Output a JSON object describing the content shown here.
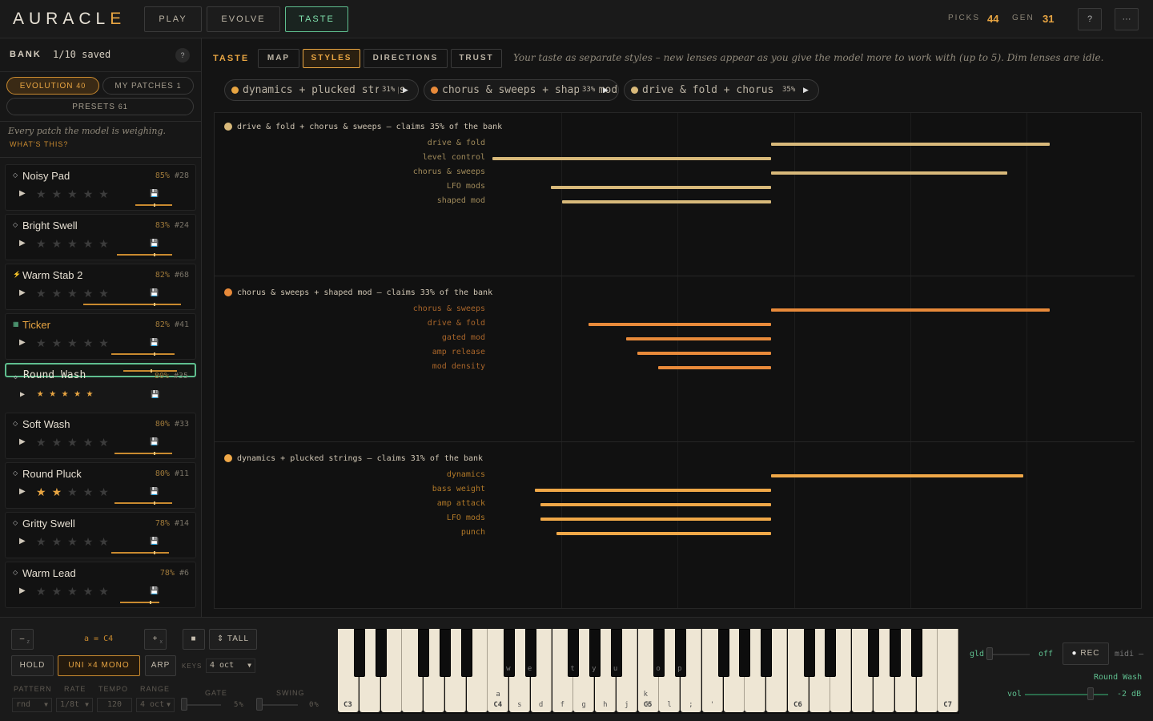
{
  "app": {
    "logo": "AURACLE",
    "logo_main": "AURACL",
    "logo_last": "E"
  },
  "top_tabs": [
    {
      "label": "PLAY"
    },
    {
      "label": "EVOLVE"
    },
    {
      "label": "TASTE",
      "active": true
    }
  ],
  "stats": {
    "picks_label": "PICKS",
    "picks": "44",
    "gen_label": "GEN",
    "gen": "31"
  },
  "top_buttons": {
    "help": "?",
    "more": "···"
  },
  "sidebar": {
    "bank_label": "BANK",
    "bank_saved": "1/10 saved",
    "help": "?",
    "filters": [
      {
        "label": "EVOLUTION",
        "count": "40",
        "active": true
      },
      {
        "label": "MY PATCHES",
        "count": "1"
      },
      {
        "label": "PRESETS",
        "count": "61"
      }
    ],
    "note": "Every patch the model is weighing.",
    "whats_this": "WHAT'S THIS?",
    "patches": [
      {
        "name": "Noisy Pad",
        "marker": "◇",
        "score": "85%",
        "id": "#28",
        "stars_lit": 0,
        "bar_start": 0.7,
        "bar_end": 0.9,
        "tick": 0.8
      },
      {
        "name": "Bright Swell",
        "marker": "◇",
        "score": "83%",
        "id": "#24",
        "stars_lit": 0,
        "bar_start": 0.6,
        "bar_end": 0.9,
        "tick": 0.8
      },
      {
        "name": "Warm Stab 2",
        "marker": "⚡",
        "score": "82%",
        "id": "#68",
        "stars_lit": 0,
        "bar_start": 0.42,
        "bar_end": 0.95,
        "tick": 0.8
      },
      {
        "name": "Ticker",
        "marker": "▦",
        "score": "82%",
        "id": "#41",
        "stars_lit": 0,
        "bar_start": 0.57,
        "bar_end": 0.91,
        "tick": 0.8,
        "highlight": true
      },
      {
        "name": "Round Wash",
        "marker": "◇",
        "score": "80%",
        "id": "#35",
        "stars_lit": 5,
        "selected": true,
        "bar_start": 0.63,
        "bar_end": 0.92,
        "tick": 0.78
      },
      {
        "name": "Soft Wash",
        "marker": "◇",
        "score": "80%",
        "id": "#33",
        "stars_lit": 0,
        "bar_start": 0.59,
        "bar_end": 0.9,
        "tick": 0.8
      },
      {
        "name": "Round Pluck",
        "marker": "◇",
        "score": "80%",
        "id": "#11",
        "stars_lit": 2,
        "bar_start": 0.59,
        "bar_end": 0.9,
        "tick": 0.8
      },
      {
        "name": "Gritty Swell",
        "marker": "◇",
        "score": "78%",
        "id": "#14",
        "stars_lit": 0,
        "bar_start": 0.57,
        "bar_end": 0.88,
        "tick": 0.8
      },
      {
        "name": "Warm Lead",
        "marker": "◇",
        "score": "78%",
        "id": "#6",
        "stars_lit": 0,
        "bar_start": 0.62,
        "bar_end": 0.83,
        "tick": 0.78
      }
    ]
  },
  "main": {
    "section_label": "TASTE",
    "subtabs": [
      {
        "label": "MAP"
      },
      {
        "label": "STYLES",
        "active": true
      },
      {
        "label": "DIRECTIONS"
      },
      {
        "label": "TRUST"
      }
    ],
    "description": "Your taste as separate styles – new lenses appear as you give the model more to work with (up to 5). Dim lenses are idle.",
    "lenses": [
      {
        "label": "dynamics + plucked strings",
        "pct": "31%",
        "color": "#e8a542"
      },
      {
        "label": "chorus & sweeps + shaped mod",
        "pct": "33%",
        "color": "#e88a3a"
      },
      {
        "label": "drive & fold + chorus",
        "pct": "35%",
        "color": "#d8b97a"
      }
    ]
  },
  "styles": [
    {
      "title": "drive & fold + chorus & sweeps — claims 35% of the bank",
      "color": "#d8b97a",
      "label_color": "#a08a5a",
      "rows": [
        {
          "label": "drive & fold",
          "value": 0.52
        },
        {
          "label": "level control",
          "value": -0.52
        },
        {
          "label": "chorus & sweeps",
          "value": 0.44
        },
        {
          "label": "LFO mods",
          "value": -0.41
        },
        {
          "label": "shaped mod",
          "value": -0.39
        }
      ]
    },
    {
      "title": "chorus & sweeps + shaped mod — claims 33% of the bank",
      "color": "#e88a3a",
      "label_color": "#a8652a",
      "rows": [
        {
          "label": "chorus & sweeps",
          "value": 0.52
        },
        {
          "label": "drive & fold",
          "value": -0.34
        },
        {
          "label": "gated mod",
          "value": -0.27
        },
        {
          "label": "amp release",
          "value": -0.25
        },
        {
          "label": "mod density",
          "value": -0.21
        }
      ]
    },
    {
      "title": "dynamics + plucked strings — claims 31% of the bank",
      "color": "#f0a848",
      "label_color": "#b07828",
      "rows": [
        {
          "label": "dynamics",
          "value": 0.47
        },
        {
          "label": "bass weight",
          "value": -0.44
        },
        {
          "label": "amp attack",
          "value": -0.43
        },
        {
          "label": "LFO mods",
          "value": -0.43
        },
        {
          "label": "punch",
          "value": -0.4
        }
      ]
    }
  ],
  "bottom": {
    "octave_down": "–",
    "octave_down_key": "z",
    "key_map": "a = C4",
    "octave_up": "+",
    "octave_up_key": "x",
    "stop": "■",
    "tall": "⇕ TALL",
    "hold": "HOLD",
    "voice_mode": "UNI ×4 MONO",
    "arp": "ARP",
    "keys_label": "KEYS",
    "keys_value": "4 oct",
    "pattern_label": "PATTERN",
    "rate_label": "RATE",
    "tempo_label": "TEMPO",
    "range_label": "RANGE",
    "pattern": "rnd",
    "rate": "1/8t",
    "tempo": "120",
    "range": "4 oct",
    "gate_label": "GATE",
    "gate_value": "5%",
    "swing_label": "SWING",
    "swing_value": "0%",
    "gld_label": "gld",
    "gld_value": "off",
    "rec": "REC",
    "midi": "midi –",
    "patch_name": "Round Wash",
    "vol_label": "vol",
    "vol_value": "-2 dB"
  },
  "keyboard": {
    "octave_labels": [
      "C3",
      "C4",
      "C5",
      "C6",
      "C7"
    ],
    "white_keys": [
      "a",
      "s",
      "d",
      "f",
      "g",
      "h",
      "j",
      "k",
      "l",
      ";",
      "'"
    ],
    "black_keys": [
      "w",
      "e",
      "t",
      "y",
      "u",
      "o",
      "p"
    ],
    "key_c5": "k"
  }
}
